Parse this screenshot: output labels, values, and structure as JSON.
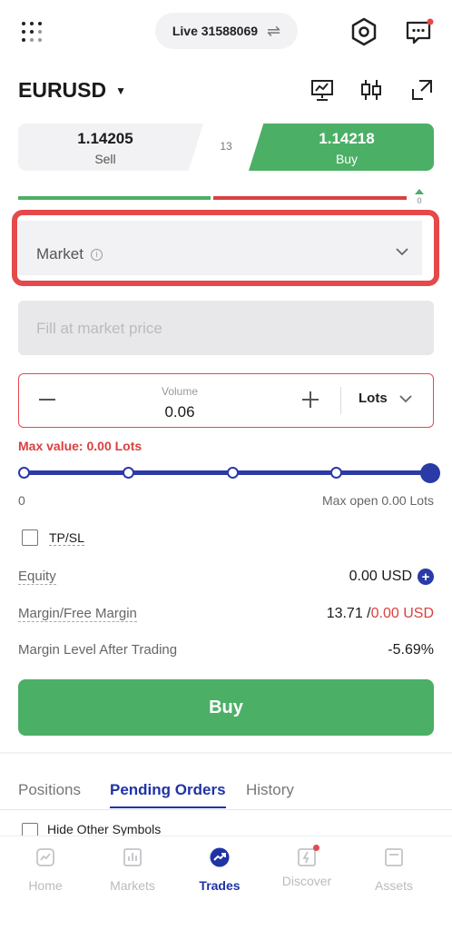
{
  "header": {
    "account_label": "Live 31588069",
    "swap_icon": "⇌"
  },
  "symbol": {
    "name": "EURUSD",
    "caret": "▼"
  },
  "prices": {
    "sell_price": "1.14205",
    "sell_label": "Sell",
    "spread": "13",
    "buy_price": "1.14218",
    "buy_label": "Buy",
    "ratio_value": "0"
  },
  "order_type": {
    "label": "Market",
    "info_glyph": "i"
  },
  "fill": {
    "placeholder": "Fill at market price"
  },
  "volume": {
    "label": "Volume",
    "value": "0.06",
    "unit": "Lots"
  },
  "max_value": "Max value: 0.00 Lots",
  "slider": {
    "min_label": "0",
    "max_label": "Max open 0.00 Lots",
    "level": 1.0
  },
  "tpsl": {
    "label": "TP/SL"
  },
  "account_info": {
    "equity_label": "Equity",
    "equity_value": "0.00 USD",
    "margin_label": "Margin/Free Margin",
    "margin_value": "13.71 /",
    "free_margin_value": "0.00 USD",
    "margin_level_label": "Margin Level After Trading",
    "margin_level_value": "-5.69%"
  },
  "buy_button": "Buy",
  "tabs": {
    "positions": "Positions",
    "pending": "Pending Orders",
    "history": "History"
  },
  "hide_other": "Hide Other Symbols",
  "nav": {
    "home": "Home",
    "markets": "Markets",
    "trades": "Trades",
    "discover": "Discover",
    "assets": "Assets"
  },
  "colors": {
    "buy_green": "#4caf66",
    "sell_red": "#d9413f",
    "accent_blue": "#1f33a6",
    "highlight_red": "#e5494b"
  }
}
